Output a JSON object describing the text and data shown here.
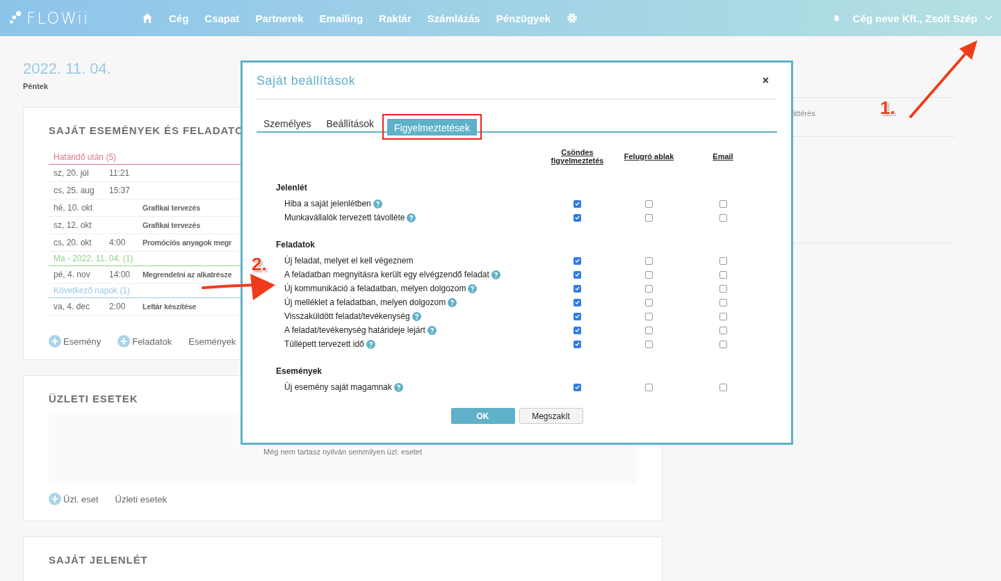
{
  "topbar": {
    "logo": "FLOWii",
    "nav": [
      {
        "label": "Cég"
      },
      {
        "label": "Csapat"
      },
      {
        "label": "Partnerek"
      },
      {
        "label": "Emailing"
      },
      {
        "label": "Raktár"
      },
      {
        "label": "Számlázás"
      },
      {
        "label": "Pénzügyek"
      }
    ],
    "account": "Cég neve Kft., Zsolt Szép"
  },
  "date": "2022. 11. 04.",
  "weekday": "Péntek",
  "events_card": {
    "title": "SAJÁT ESEMÉNYEK ÉS FELADATO",
    "groups": [
      {
        "label": "Határidő után (5)",
        "color": "#e0788a",
        "rows": [
          {
            "date": "sz, 20. júl",
            "time": "11:21"
          },
          {
            "date": "cs, 25. aug",
            "time": "15:37"
          },
          {
            "date": "hé, 10. okt",
            "title": "Grafikai tervezés"
          },
          {
            "date": "sz, 12. okt",
            "title": "Grafikai tervezés"
          },
          {
            "date": "cs, 20. okt",
            "time": "4:00",
            "title": "Promóciós anyagok megr"
          }
        ]
      },
      {
        "label": "Ma - 2022. 11. 04. (1)",
        "color": "#8fd18b",
        "rows": [
          {
            "date": "pé, 4. nov",
            "time": "14:00",
            "title": "Megrendelni az alkatrésze"
          }
        ]
      },
      {
        "label": "Következő napok (1)",
        "color": "#9cc9e6",
        "rows": [
          {
            "date": "va, 4. dec",
            "time": "2:00",
            "title": "Leltár készítése"
          }
        ]
      }
    ],
    "actions": [
      {
        "label": "Esemény",
        "kind": "add"
      },
      {
        "label": "Feladatok",
        "kind": "add"
      },
      {
        "label": "Események",
        "kind": "link"
      }
    ]
  },
  "cases_card": {
    "title": "ÜZLETI ESETEK",
    "empty_text": "Még nem tartasz nyilván semmilyen üzl. esetet",
    "actions": [
      {
        "label": "Üzl. eset",
        "kind": "add"
      },
      {
        "label": "Üzleti esetek",
        "kind": "link"
      }
    ]
  },
  "presence_card": {
    "title": "SAJÁT JELENLÉT"
  },
  "side_text": "áttérés",
  "modal": {
    "title": "Saját beállítások",
    "close": "×",
    "tabs": [
      {
        "label": "Személyes",
        "selected": false,
        "highlighted": false
      },
      {
        "label": "Beállítások",
        "selected": false,
        "highlighted": false
      },
      {
        "label": "Figyelmeztetések",
        "selected": true,
        "highlighted": true
      }
    ],
    "columns": [
      "Csöndes figyelmeztetés",
      "Felugró ablak",
      "Email"
    ],
    "sections": [
      {
        "title": "Jelenlét",
        "items": [
          {
            "label": "Hiba a saját jelenlétben",
            "help": true,
            "checks": [
              true,
              false,
              false
            ]
          },
          {
            "label": "Munkavállalók tervezett távolléte",
            "help": true,
            "checks": [
              true,
              false,
              false
            ]
          }
        ]
      },
      {
        "title": "Feladatok",
        "items": [
          {
            "label": "Új feladat, melyet el kell végeznem",
            "help": false,
            "checks": [
              true,
              false,
              false
            ]
          },
          {
            "label": "A feladatban megnyitásra került egy elvégzendő feladat",
            "help": true,
            "checks": [
              true,
              false,
              false
            ]
          },
          {
            "label": "Új kommunikáció a feladatban, melyen dolgozom",
            "help": true,
            "checks": [
              true,
              false,
              false
            ]
          },
          {
            "label": "Új melléklet a feladatban, melyen dolgozom",
            "help": true,
            "checks": [
              true,
              false,
              false
            ]
          },
          {
            "label": "Visszaküldött feladat/tevékenység",
            "help": true,
            "checks": [
              true,
              false,
              false
            ]
          },
          {
            "label": "A feladat/tevékenység határideje lejárt",
            "help": true,
            "checks": [
              true,
              false,
              false
            ]
          },
          {
            "label": "Túllépett tervezett idő",
            "help": true,
            "checks": [
              true,
              false,
              false
            ]
          }
        ]
      },
      {
        "title": "Események",
        "items": [
          {
            "label": "Új esemény saját magamnak",
            "help": true,
            "checks": [
              true,
              false,
              false
            ]
          }
        ]
      }
    ],
    "buttons": [
      {
        "label": "OK",
        "kind": "primary"
      },
      {
        "label": "Megszakít",
        "kind": "secondary"
      }
    ]
  },
  "annotations": [
    {
      "label": "1."
    },
    {
      "label": "2."
    }
  ]
}
